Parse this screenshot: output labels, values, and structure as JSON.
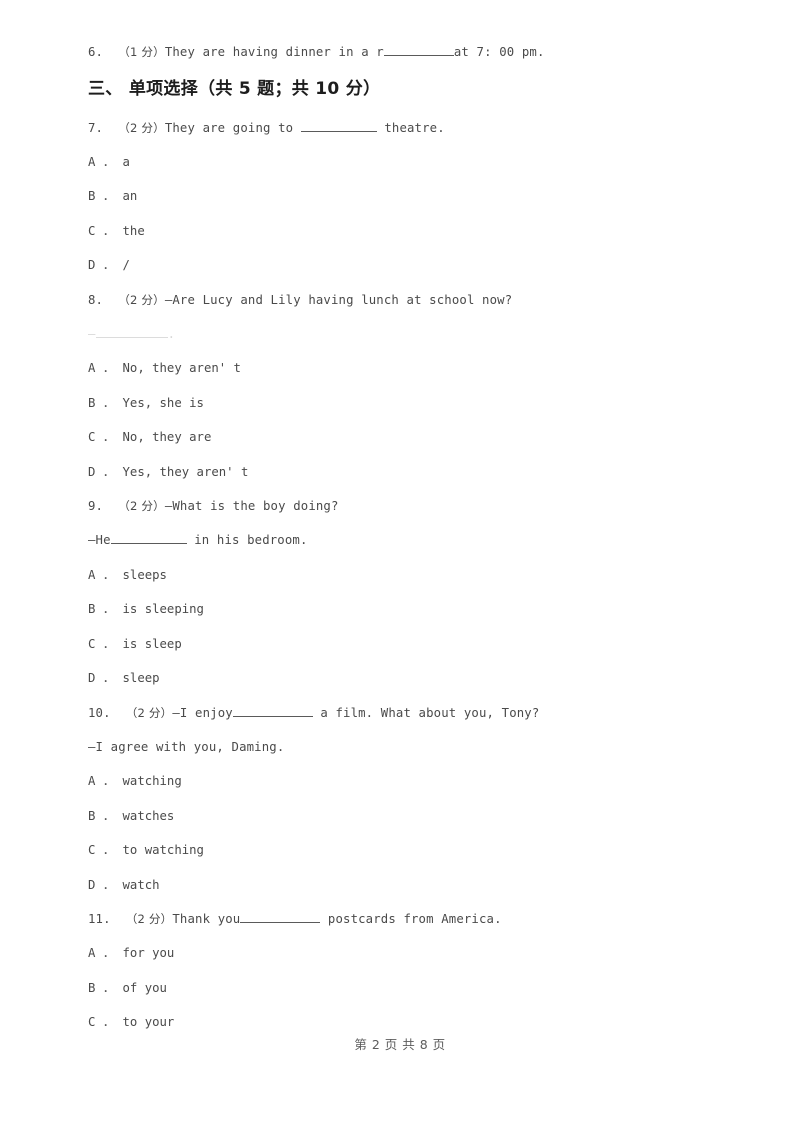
{
  "document": {
    "type": "exam-paper-page",
    "page_footer": "第 2 页 共 8 页"
  },
  "carryover_question": {
    "number": "6.",
    "score": "（1 分）",
    "text_before_blank": "They are having dinner in a r",
    "text_after_blank": "at 7: 00 pm."
  },
  "section": {
    "heading": "三、 单项选择（共 5 题；共 10 分）"
  },
  "questions": [
    {
      "number": "7.",
      "score": "（2 分）",
      "stem_before_blank": "They are going to ",
      "stem_after_blank": " theatre.",
      "options": [
        "A ． a",
        "B ． an",
        "C ． the",
        "D ． /"
      ]
    },
    {
      "number": "8.",
      "score": "（2 分）",
      "stem_before_blank": "—Are Lucy and Lily having lunch at school now?",
      "answer_line_prefix": "—",
      "answer_line_suffix": ".",
      "options": [
        "A ． No, they aren' t",
        "B ． Yes, she is",
        "C ． No, they are",
        "D ． Yes, they aren' t"
      ]
    },
    {
      "number": "9.",
      "score": "（2 分）",
      "stem_before_blank": "—What is the boy doing?",
      "answer_line_prefix": "—He",
      "answer_line_suffix": " in his bedroom.",
      "options": [
        "A ． sleeps",
        "B ． is sleeping",
        "C ． is sleep",
        "D ． sleep"
      ]
    },
    {
      "number": "10.",
      "score": "（2 分）",
      "stem_before_blank": "—I enjoy",
      "stem_after_blank": " a film. What about you, Tony?",
      "answer_line": "—I agree with you, Daming.",
      "options": [
        "A ． watching",
        "B ． watches",
        "C ． to watching",
        "D ． watch"
      ]
    },
    {
      "number": "11.",
      "score": "（2 分）",
      "stem_before_blank": "Thank you",
      "stem_after_blank": " postcards from America.",
      "options": [
        "A ． for you",
        "B ． of you",
        "C ． to your"
      ]
    }
  ]
}
